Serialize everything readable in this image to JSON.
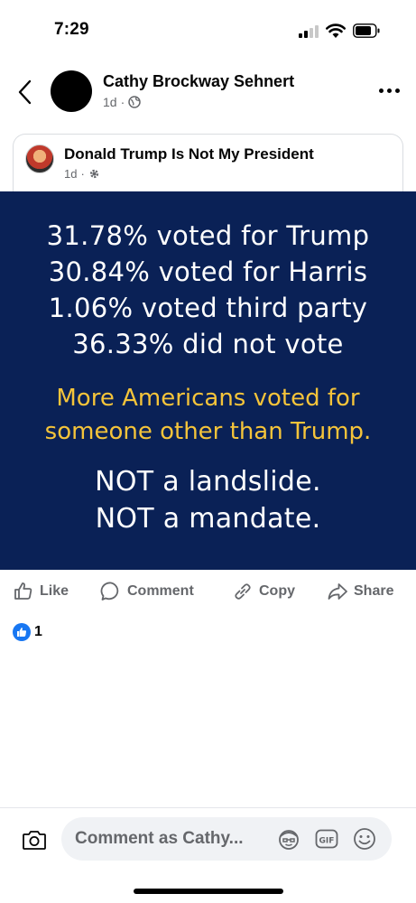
{
  "status_bar": {
    "time": "7:29",
    "signal_icon": "signal-bars-icon",
    "wifi_icon": "wifi-icon",
    "battery_icon": "battery-icon"
  },
  "header": {
    "author_name": "Cathy Brockway Sehnert",
    "timestamp": "1d",
    "separator": "·",
    "privacy_icon": "globe-icon"
  },
  "shared_post": {
    "group_name": "Donald Trump Is Not My President",
    "timestamp": "1d",
    "separator": "·",
    "privacy_icon": "settings-icon"
  },
  "post_image": {
    "background_color": "#0a2156",
    "stats": [
      "31.78% voted for Trump",
      "30.84% voted for Harris",
      "1.06% voted third party",
      "36.33% did not vote"
    ],
    "callout_color": "#f5c43a",
    "callout": [
      "More Americans voted for",
      "someone other than Trump."
    ],
    "closing": [
      "NOT a landslide.",
      "NOT a mandate."
    ]
  },
  "actions": {
    "like_label": "Like",
    "comment_label": "Comment",
    "copy_label": "Copy",
    "share_label": "Share"
  },
  "reactions": {
    "count": "1",
    "accent_color": "#1877f2"
  },
  "comment_bar": {
    "placeholder": "Comment as Cathy..."
  }
}
